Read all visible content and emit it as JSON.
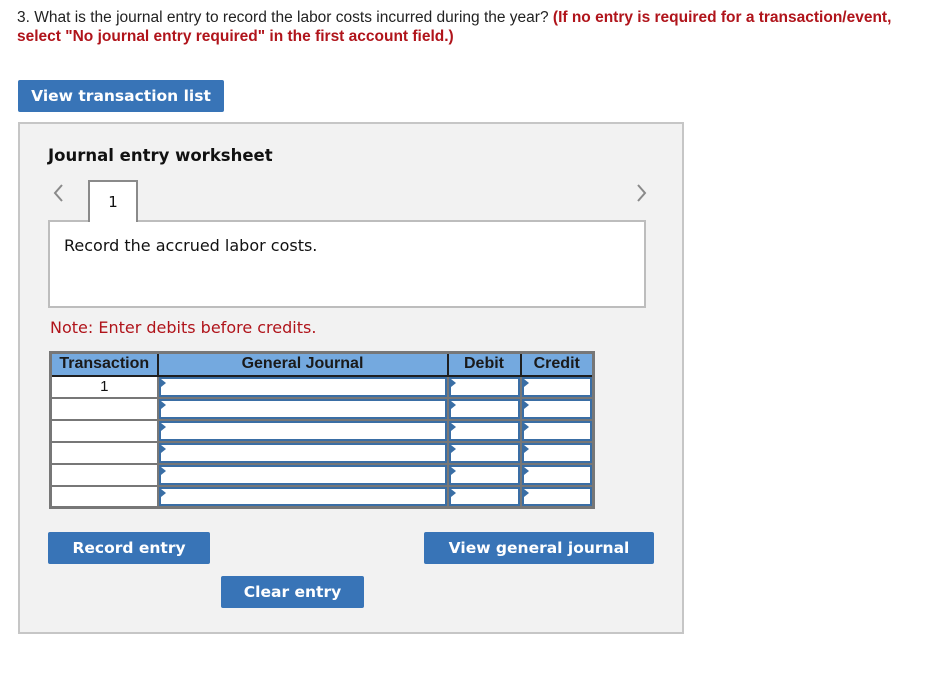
{
  "question": {
    "text": "3. What is the journal entry to record the labor costs incurred during the year?",
    "instruction": "(If no entry is required for a transaction/event, select \"No journal entry required\" in the first account field.)"
  },
  "buttons": {
    "view_transaction_list": "View transaction list",
    "record_entry": "Record entry",
    "clear_entry": "Clear entry",
    "view_general_journal": "View general journal"
  },
  "worksheet": {
    "title": "Journal entry worksheet",
    "active_tab": "1",
    "description": "Record the accrued labor costs.",
    "note": "Note: Enter debits before credits.",
    "nav": {
      "prev_icon": "chevron-left-icon",
      "next_icon": "chevron-right-icon"
    }
  },
  "journal_table": {
    "headers": [
      "Transaction",
      "General Journal",
      "Debit",
      "Credit"
    ],
    "rows": [
      {
        "transaction": "1",
        "account": "",
        "debit": "",
        "credit": ""
      },
      {
        "transaction": "",
        "account": "",
        "debit": "",
        "credit": ""
      },
      {
        "transaction": "",
        "account": "",
        "debit": "",
        "credit": ""
      },
      {
        "transaction": "",
        "account": "",
        "debit": "",
        "credit": ""
      },
      {
        "transaction": "",
        "account": "",
        "debit": "",
        "credit": ""
      },
      {
        "transaction": "",
        "account": "",
        "debit": "",
        "credit": ""
      }
    ]
  },
  "colors": {
    "button_blue": "#3874b7",
    "header_blue": "#74a9df",
    "instruction_red": "#b0141b",
    "panel_bg": "#f2f2f2"
  }
}
